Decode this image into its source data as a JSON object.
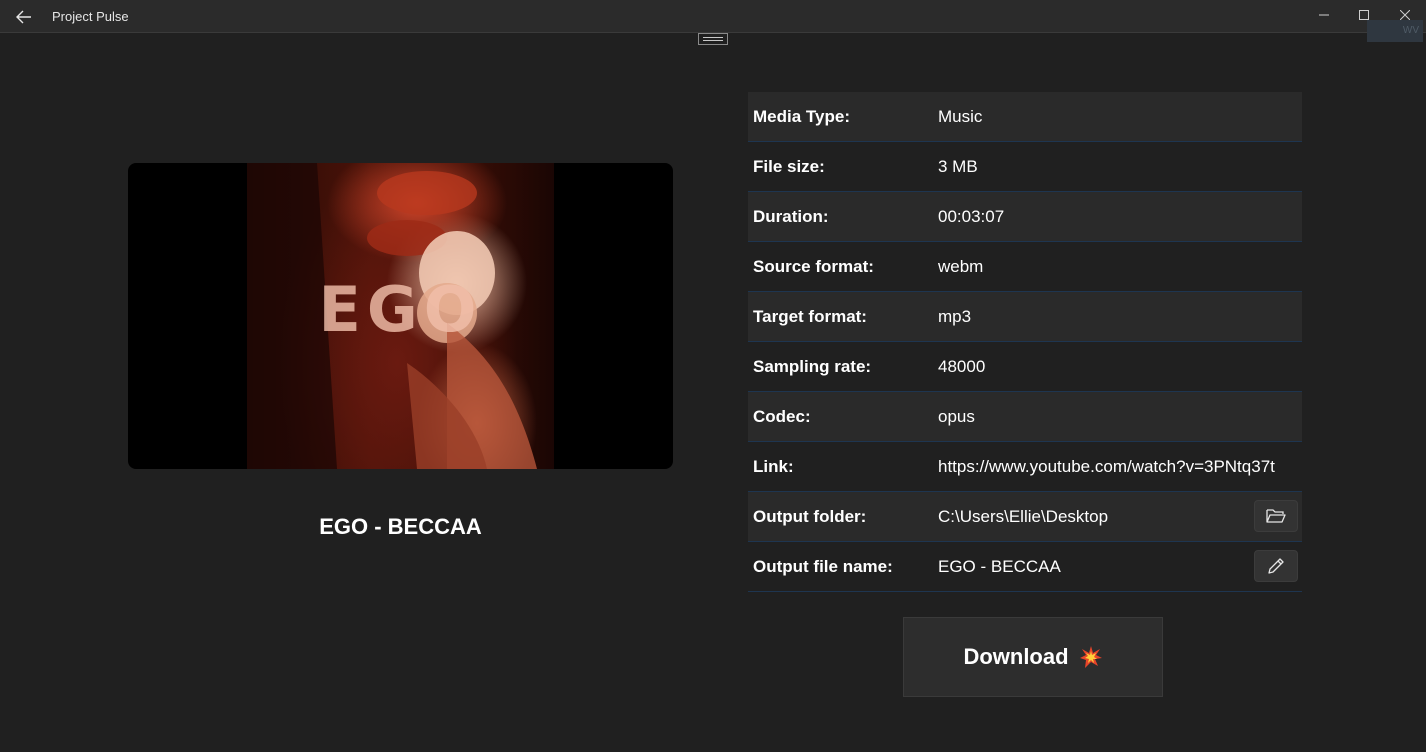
{
  "window": {
    "title": "Project Pulse",
    "ghost_badge": "WV"
  },
  "thumbnail": {
    "overlay_text": "EGO"
  },
  "media": {
    "title": "EGO - BECCAA"
  },
  "details": [
    {
      "label": "Media Type:",
      "value": "Music"
    },
    {
      "label": "File size:",
      "value": "3 MB"
    },
    {
      "label": "Duration:",
      "value": "00:03:07"
    },
    {
      "label": "Source format:",
      "value": "webm"
    },
    {
      "label": "Target format:",
      "value": "mp3"
    },
    {
      "label": "Sampling rate:",
      "value": "48000"
    },
    {
      "label": "Codec:",
      "value": "opus"
    },
    {
      "label": "Link:",
      "value": "https://www.youtube.com/watch?v=3PNtq37t"
    },
    {
      "label": "Output folder:",
      "value": "C:\\Users\\Ellie\\Desktop",
      "action_icon": "folder-open-icon"
    },
    {
      "label": "Output file name:",
      "value": "EGO - BECCAA",
      "action_icon": "pencil-icon"
    }
  ],
  "download": {
    "label": "Download",
    "icon": "collision-burst-icon"
  },
  "colors": {
    "background": "#202020",
    "titlebar": "#2b2b2b",
    "row_alt": "#2a2a2a",
    "row_divider": "#1e3550",
    "button": "#2d2d2d"
  }
}
